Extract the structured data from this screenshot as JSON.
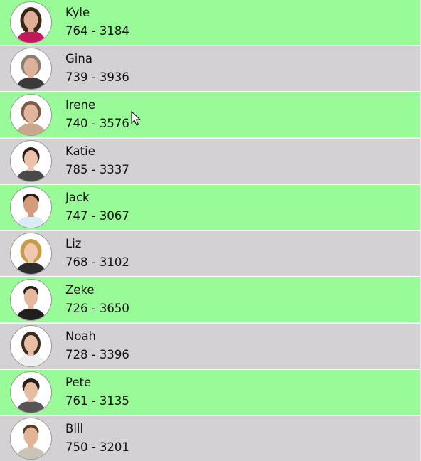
{
  "contacts": [
    {
      "name": "Kyle",
      "phone": "764 - 3184",
      "hair": "#3a2418",
      "clothes": "#c2185b",
      "skin": "#e0b096"
    },
    {
      "name": "Gina",
      "phone": "739 - 3936",
      "hair": "#8a7d74",
      "clothes": "#3a3a3a",
      "skin": "#dcb29a"
    },
    {
      "name": "Irene",
      "phone": "740 - 3576",
      "hair": "#7b5a48",
      "clothes": "#c9a78e",
      "skin": "#e2b69c"
    },
    {
      "name": "Katie",
      "phone": "785 - 3337",
      "hair": "#2b1d16",
      "clothes": "#4a4a4a",
      "skin": "#ecc3aa"
    },
    {
      "name": "Jack",
      "phone": "747 - 3067",
      "hair": "#2a1c14",
      "clothes": "#d9ecf4",
      "skin": "#d49c7c"
    },
    {
      "name": "Liz",
      "phone": "768 - 3102",
      "hair": "#c99a4a",
      "clothes": "#2c2c2c",
      "skin": "#efc9ae"
    },
    {
      "name": "Zeke",
      "phone": "726 - 3650",
      "hair": "#2b2018",
      "clothes": "#1f1f1f",
      "skin": "#e4b89c"
    },
    {
      "name": "Noah",
      "phone": "728 - 3396",
      "hair": "#3b2a1f",
      "clothes": "#eeeeee",
      "skin": "#e8bfa4"
    },
    {
      "name": "Pete",
      "phone": "761 - 3135",
      "hair": "#2a1d16",
      "clothes": "#555555",
      "skin": "#e6bca2"
    },
    {
      "name": "Bill",
      "phone": "750 - 3201",
      "hair": "#5a3b24",
      "clothes": "#c9c3b8",
      "skin": "#e2b496"
    }
  ],
  "colors": {
    "row_even": "#98fb98",
    "row_odd": "#d3d1d4",
    "text": "#111111"
  },
  "cursor_icon": "arrow-cursor-icon"
}
